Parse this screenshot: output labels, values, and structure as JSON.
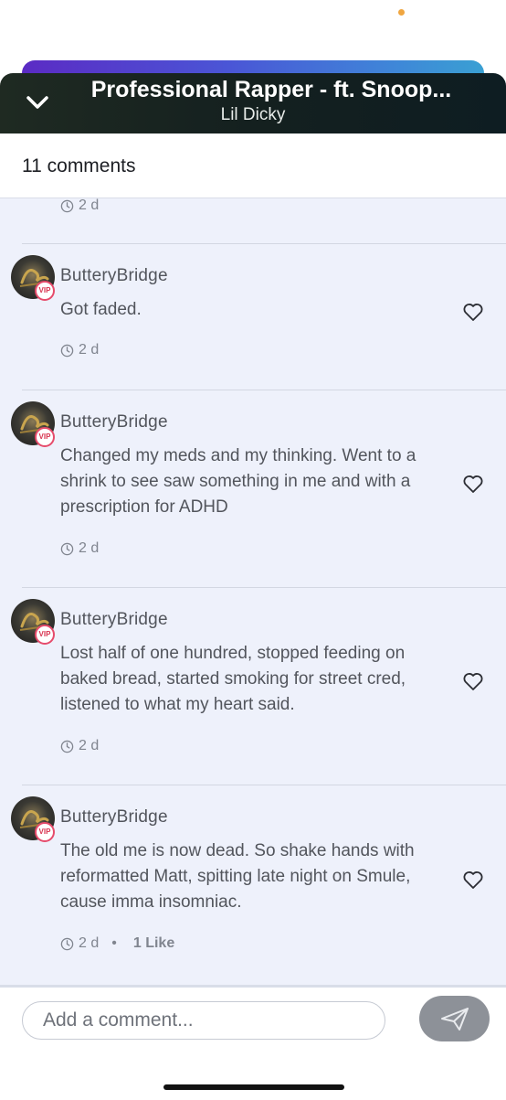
{
  "player": {
    "title": "Professional Rapper - ft. Snoop...",
    "artist": "Lil Dicky"
  },
  "comments_header": {
    "count_label": "11 comments"
  },
  "partial_comment": {
    "time": "2 d"
  },
  "comments": [
    {
      "username": "ButteryBridge",
      "badge": "VIP",
      "text": "Got faded.",
      "time": "2 d"
    },
    {
      "username": "ButteryBridge",
      "badge": "VIP",
      "text": "Changed my meds and my thinking. Went to a shrink to see saw something in me and with a prescription for ADHD",
      "time": "2 d"
    },
    {
      "username": "ButteryBridge",
      "badge": "VIP",
      "text": "Lost half of one hundred, stopped feeding on baked bread, started smoking for street cred, listened to what my heart said.",
      "time": "2 d"
    },
    {
      "username": "ButteryBridge",
      "badge": "VIP",
      "text": "The old me is now dead. So shake hands with reformatted Matt, spitting late night on Smule, cause imma insomniac.",
      "time": "2 d",
      "separator": "•",
      "likes": "1 Like"
    }
  ],
  "composer": {
    "placeholder": "Add a comment..."
  },
  "colors": {
    "accent_gradient_start": "#5b2bc4",
    "accent_gradient_end": "#3aa0d3",
    "player_bg": "#14201f",
    "list_bg": "#eef1fb",
    "vip_ring": "#e64b6b",
    "send_button": "#8d9198"
  }
}
